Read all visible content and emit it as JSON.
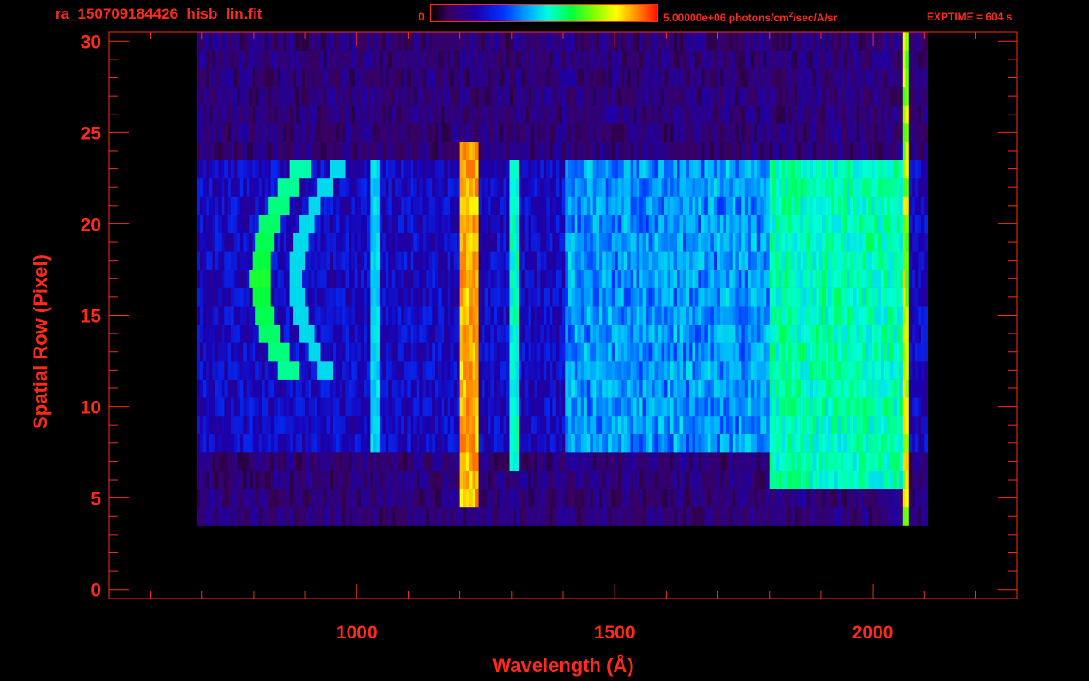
{
  "header": {
    "filename": "ra_150709184426_hisb_lin.fit",
    "colorbar_min": "0",
    "colorbar_max_value": "5.00000e+06",
    "colorbar_unit": " photons/cm",
    "colorbar_unit_sup": "2",
    "colorbar_unit_tail": "/sec/A/sr",
    "exptime": "EXPTIME = 604 s"
  },
  "chart_data": {
    "type": "heatmap",
    "title": "ra_150709184426_hisb_lin.fit",
    "xlabel": "Wavelength (Å)",
    "ylabel": "Spatial Row (Pixel)",
    "xlim": [
      520,
      2280
    ],
    "ylim": [
      -0.5,
      30.5
    ],
    "x_ticks": [
      1000,
      1500,
      2000
    ],
    "y_ticks": [
      0,
      5,
      10,
      15,
      20,
      25,
      30
    ],
    "x_minor_step": 100,
    "y_minor_step": 1,
    "colorbar": {
      "min": 0,
      "max": 5000000,
      "unit": "photons/cm^2/sec/A/sr"
    },
    "colormap": [
      "#000000",
      "#3a0060",
      "#1a00b0",
      "#0033ff",
      "#00b4ff",
      "#00ffd8",
      "#00ff40",
      "#7fff00",
      "#ffff00",
      "#ff8000",
      "#ff1000"
    ],
    "data_extent": {
      "x_range": [
        690,
        2100
      ],
      "row_range": [
        4,
        30
      ]
    },
    "features": [
      {
        "name": "Lyman-alpha emission",
        "wavelength": 1216,
        "rows": [
          5,
          24
        ],
        "level": 0.92
      },
      {
        "name": "emission line",
        "wavelength": 1030,
        "rows": [
          8,
          23
        ],
        "level": 0.5
      },
      {
        "name": "emission line",
        "wavelength": 1304,
        "rows": [
          7,
          23
        ],
        "level": 0.55
      },
      {
        "name": "extended continuum",
        "x_range": [
          1800,
          2060
        ],
        "rows": [
          6,
          23
        ],
        "level": 0.55
      },
      {
        "name": "detector edge",
        "wavelength": 2060,
        "rows": [
          1,
          30
        ],
        "level": 0.85
      }
    ],
    "grid": false
  }
}
